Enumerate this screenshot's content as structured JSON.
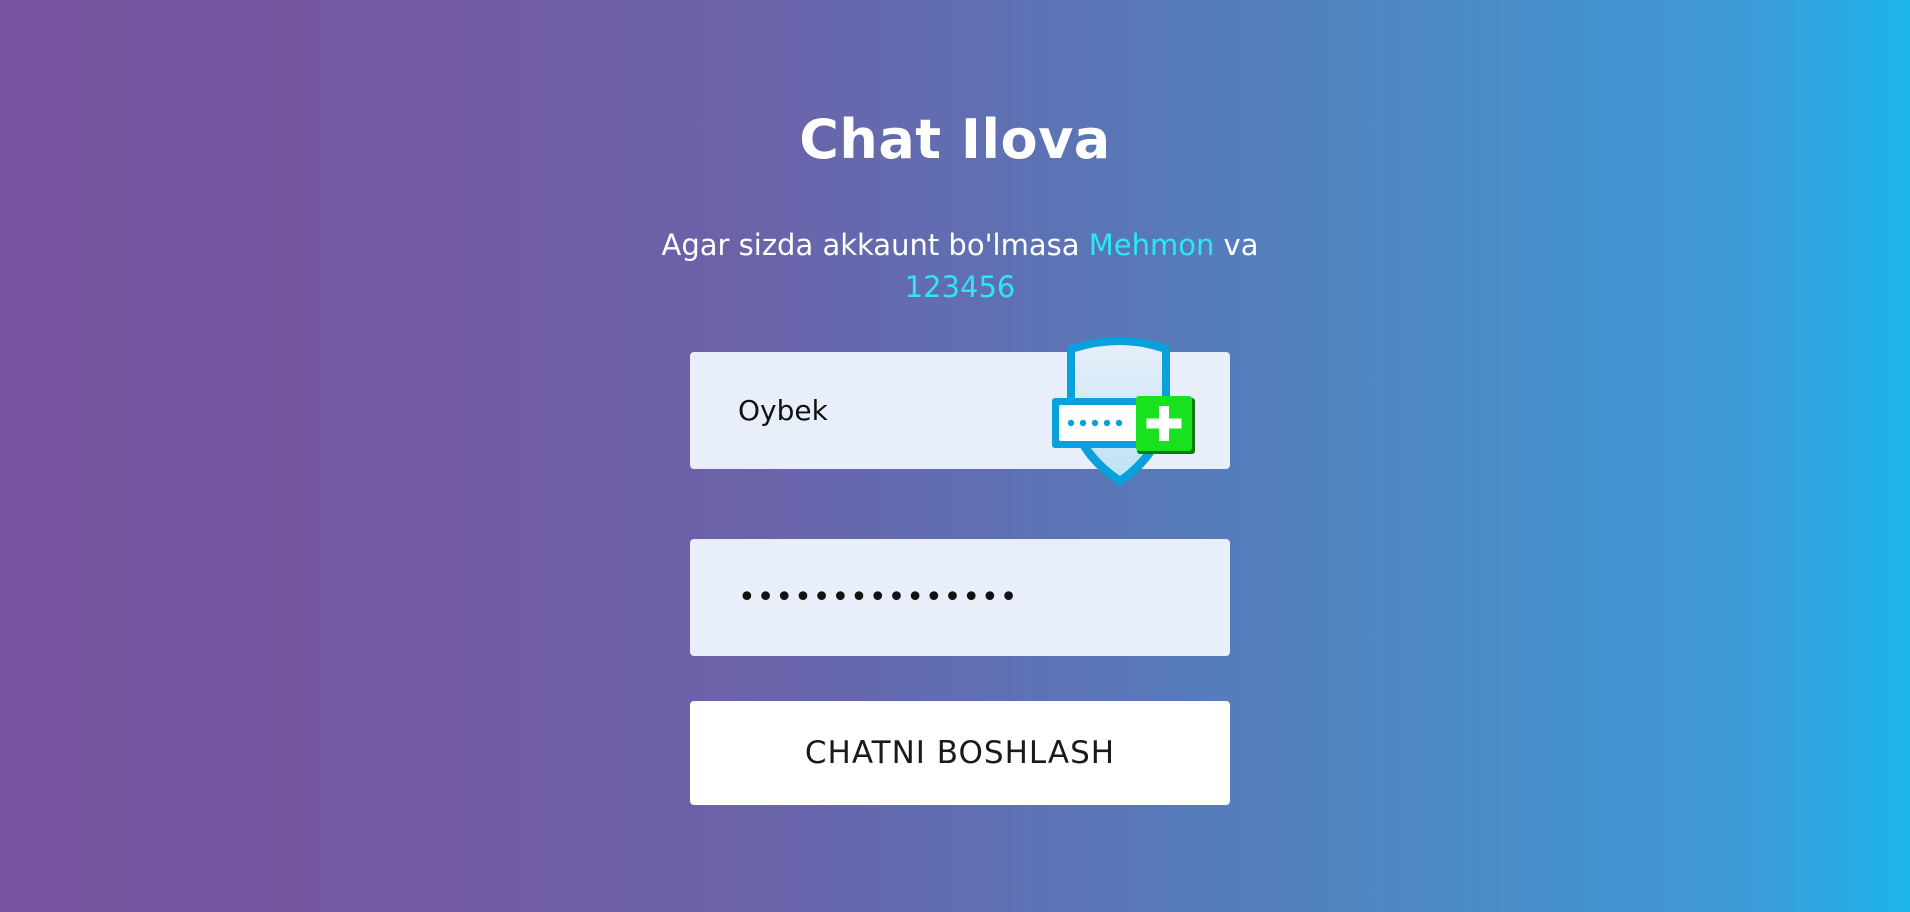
{
  "header": {
    "title": "Chat Ilova"
  },
  "info": {
    "text_before": "Agar sizda akkaunt bo'lmasa ",
    "guest_username": "Mehmon",
    "text_middle": " va",
    "guest_password": "123456"
  },
  "form": {
    "username_value": "Oybek",
    "password_masked": "•••••••••••••••",
    "submit_label": "CHATNI BOSHLASH"
  },
  "colors": {
    "gradient_start": "#7855a0",
    "gradient_end": "#1cb5ea",
    "hint_accent": "#2ee6f5",
    "field_background": "#e8effb",
    "button_background": "#ffffff"
  },
  "icons": {
    "password_manager": "password-manager-shield-icon"
  }
}
